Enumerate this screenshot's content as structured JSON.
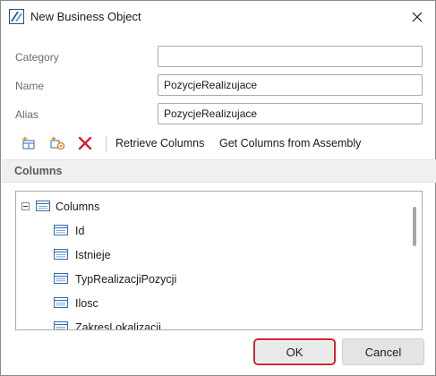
{
  "window": {
    "title": "New Business Object"
  },
  "form": {
    "category_label": "Category",
    "category_value": "",
    "name_label": "Name",
    "name_value": "PozycjeRealizujace",
    "alias_label": "Alias",
    "alias_value": "PozycjeRealizujace"
  },
  "toolbar": {
    "icons": [
      "add-column-icon",
      "add-calculated-column-icon",
      "delete-icon"
    ],
    "retrieve_label": "Retrieve Columns",
    "get_columns_label": "Get Columns from Assembly"
  },
  "columns_section": {
    "header": "Columns",
    "root_label": "Columns",
    "items": [
      {
        "label": "Id"
      },
      {
        "label": "Istnieje"
      },
      {
        "label": "TypRealizacjiPozycji"
      },
      {
        "label": "Ilosc"
      },
      {
        "label": "ZakresLokalizacji"
      }
    ]
  },
  "buttons": {
    "ok_label": "OK",
    "cancel_label": "Cancel"
  },
  "colors": {
    "ok_focus_border": "#d6202e",
    "delete_icon": "#d6202e",
    "toolbar_icon": "#2f6db3",
    "gear_icon": "#d28a1e"
  }
}
